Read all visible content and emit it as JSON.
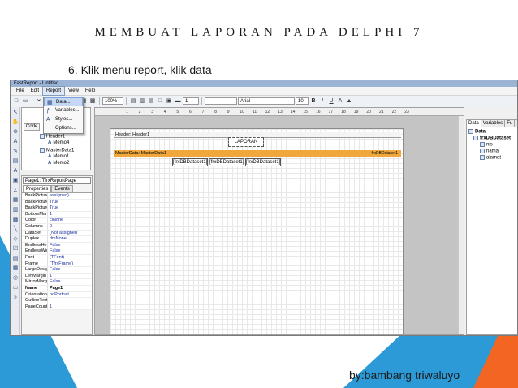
{
  "slide": {
    "title": "MEMBUAT LAPORAN PADA DELPHI 7",
    "subtitle": "6. Klik menu report, klik  data",
    "footer": "by:bambang  triwaluyo"
  },
  "colors": {
    "accent_blue": "#2b9ad6",
    "accent_orange": "#f26522",
    "band_master": "#f0a83c"
  },
  "window": {
    "title": "FastReport - Untitled"
  },
  "menubar": {
    "items": [
      "File",
      "Edit",
      "Report",
      "View",
      "Help"
    ]
  },
  "report_menu": {
    "items": [
      {
        "icon": "data-icon",
        "label": "Data..."
      },
      {
        "icon": "fx-icon",
        "label": "Variables..."
      },
      {
        "icon": "styles-icon",
        "label": "Styles..."
      },
      {
        "icon": "",
        "label": "Options..."
      }
    ]
  },
  "toolbar": {
    "zoom": "100%",
    "font_name": "Arial",
    "font_size": "10",
    "line_width": "1",
    "bold": "B",
    "italic": "I",
    "underline": "U"
  },
  "tree": {
    "code_tab": "Code",
    "items": [
      "Header1",
      "Memo4",
      "MasterData1",
      "Memo1",
      "Memo2"
    ]
  },
  "inspector": {
    "selector": "Page1: TfrxReportPage",
    "tabs": [
      "Properties",
      "Events"
    ],
    "properties": [
      {
        "name": "BackPicture",
        "value": "assigned)"
      },
      {
        "name": "BackPictureP",
        "value": "True"
      },
      {
        "name": "BackPictureV",
        "value": "True"
      },
      {
        "name": "BottomMargin",
        "value": "1"
      },
      {
        "name": "Color",
        "value": "clNone"
      },
      {
        "name": "Columns",
        "value": "0"
      },
      {
        "name": "DataSet",
        "value": "(Not assigned"
      },
      {
        "name": "Duplex",
        "value": "dmNone"
      },
      {
        "name": "EndlessHeigh",
        "value": "False"
      },
      {
        "name": "EndlessWidth",
        "value": "False"
      },
      {
        "name": "Font",
        "value": "(TFont)"
      },
      {
        "name": "Frame",
        "value": "(TfrxFrame)"
      },
      {
        "name": "LargeDesignH",
        "value": "False"
      },
      {
        "name": "LeftMargin",
        "value": "1"
      },
      {
        "name": "MirrorMargins",
        "value": "False"
      },
      {
        "name": "Name",
        "value": "Page1"
      },
      {
        "name": "Orientation",
        "value": "poPortrait"
      },
      {
        "name": "OutlineText",
        "value": ""
      },
      {
        "name": "PageCount",
        "value": "1"
      }
    ]
  },
  "ruler": {
    "numbers": [
      "1",
      "2",
      "3",
      "4",
      "5",
      "6",
      "7",
      "8",
      "9",
      "10",
      "11",
      "12",
      "13",
      "14",
      "15",
      "16",
      "17",
      "18",
      "19",
      "20",
      "21",
      "22",
      "23"
    ]
  },
  "design": {
    "header_band": "Header: Header1",
    "title_memo": "LAPORAN",
    "master_band": "MasterData: MasterData1",
    "master_dataset": "frxDBDataset1",
    "dataset_fields": [
      "[frxDBDataset1]",
      "[frxDBDataset1]",
      "[frxDBDataset1]"
    ]
  },
  "data_panel": {
    "tabs": [
      "Data",
      "Variables",
      "Fu"
    ],
    "root": "Data",
    "dataset": "frxDBDataset",
    "fields": [
      "nis",
      "nama",
      "alamat"
    ]
  }
}
